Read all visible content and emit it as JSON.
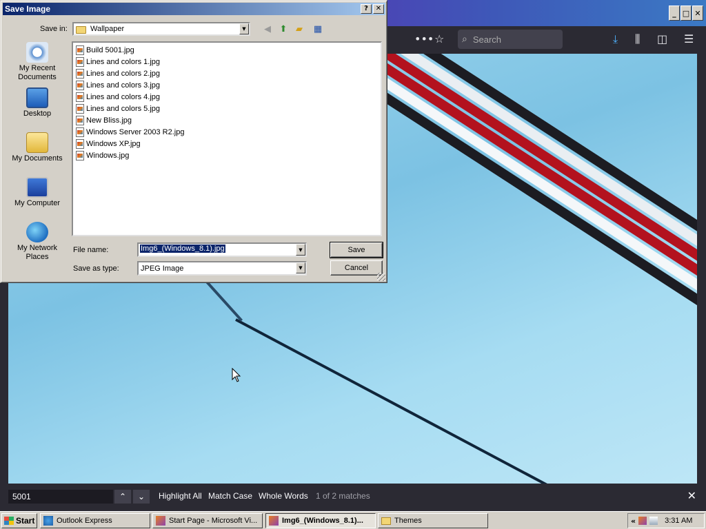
{
  "dialog": {
    "title": "Save Image",
    "help_glyph": "?",
    "close_glyph": "✕",
    "save_in_label": "Save in:",
    "save_in_value": "Wallpaper",
    "places": [
      {
        "label": "My Recent Documents",
        "icon": "recent-documents-icon"
      },
      {
        "label": "Desktop",
        "icon": "desktop-icon"
      },
      {
        "label": "My Documents",
        "icon": "my-documents-icon"
      },
      {
        "label": "My Computer",
        "icon": "my-computer-icon"
      },
      {
        "label": "My Network Places",
        "icon": "network-places-icon"
      }
    ],
    "files": [
      "Build 5001.jpg",
      "Lines and colors 1.jpg",
      "Lines and colors 2.jpg",
      "Lines and colors 3.jpg",
      "Lines and colors 4.jpg",
      "Lines and colors 5.jpg",
      "New Bliss.jpg",
      "Windows Server 2003 R2.jpg",
      "Windows XP.jpg",
      "Windows.jpg"
    ],
    "file_name_label": "File name:",
    "file_name_value": "Img6_(Windows_8.1).jpg",
    "save_as_type_label": "Save as type:",
    "save_as_type_value": "JPEG Image",
    "save_button": "Save",
    "cancel_button": "Cancel"
  },
  "browser": {
    "search_placeholder": "Search",
    "min_glyph": "_",
    "max_glyph": "□",
    "close_glyph": "✕",
    "findbar": {
      "query": "5001",
      "highlight_all": "Highlight All",
      "match_case": "Match Case",
      "whole_words": "Whole Words",
      "match_count": "1 of 2 matches"
    }
  },
  "taskbar": {
    "start_label": "Start",
    "tasks": [
      {
        "label": "Outlook Express",
        "active": false
      },
      {
        "label": "Start Page - Microsoft Vi...",
        "active": false
      },
      {
        "label": "Img6_(Windows_8.1)...",
        "active": true
      },
      {
        "label": "Themes",
        "active": false
      }
    ],
    "clock": "3:31 AM",
    "tray_chevron": "«"
  },
  "colors": {
    "dialog_title_start": "#0a246a",
    "dialog_title_end": "#a6caf0",
    "face": "#d4d0c8",
    "selection": "#0a246a",
    "browser_dark": "#2b2a33",
    "wallpaper_blue": "#8fd0ec",
    "stripe_red": "#b3121e"
  }
}
